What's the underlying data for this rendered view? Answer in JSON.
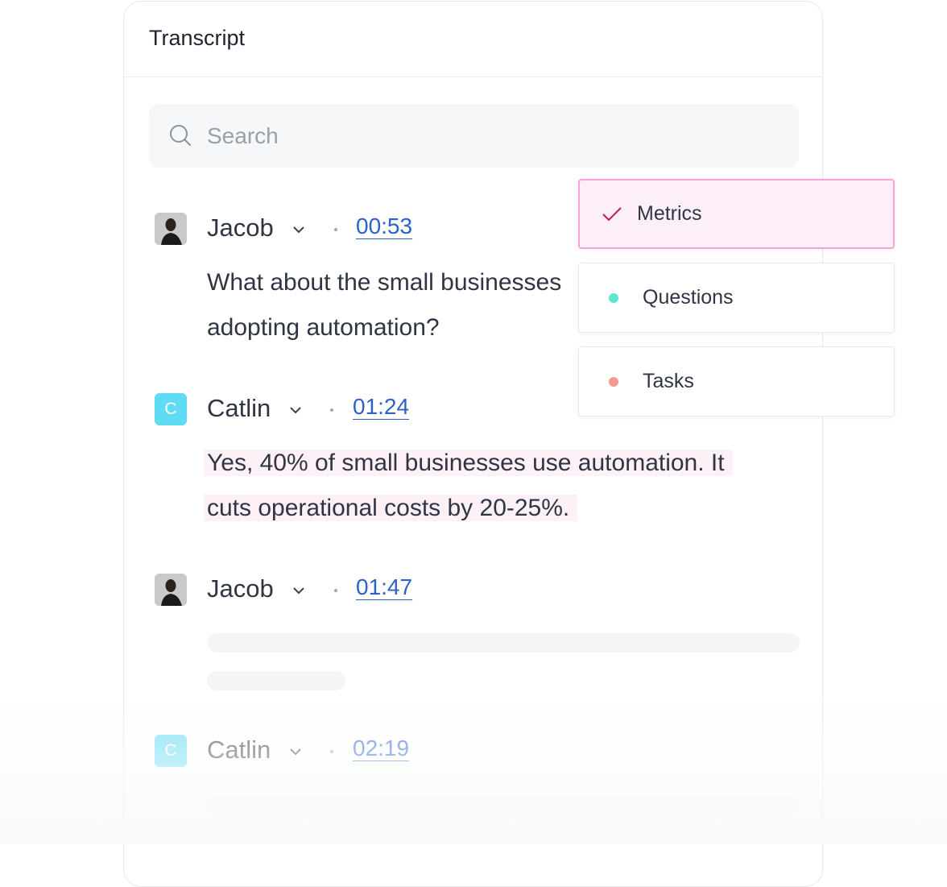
{
  "panel": {
    "title": "Transcript"
  },
  "search": {
    "placeholder": "Search",
    "icon": "search-icon"
  },
  "entries": [
    {
      "speaker": "Jacob",
      "avatar": "photo",
      "time": "00:53",
      "text_line1": "What about the small businesses",
      "text_line2": "adopting automation?"
    },
    {
      "speaker": "Catlin",
      "avatar_letter": "C",
      "time": "01:24",
      "text_line1": "Yes, 40% of small businesses use automation. It",
      "text_line2": "cuts operational costs by 20-25%.",
      "highlighted": true
    },
    {
      "speaker": "Jacob",
      "avatar": "photo",
      "time": "01:47",
      "loading": true
    },
    {
      "speaker": "Catlin",
      "avatar_letter": "C",
      "time": "02:19"
    }
  ],
  "tags": [
    {
      "label": "Metrics",
      "selected": true,
      "color": "#c2185b"
    },
    {
      "label": "Questions",
      "selected": false,
      "color": "#5ee6cf"
    },
    {
      "label": "Tasks",
      "selected": false,
      "color": "#f59a93"
    }
  ],
  "colors": {
    "link": "#2a62c9",
    "highlight": "#fdf0f7",
    "avatar_letter_bg": "#5fdcf3",
    "selected_tag_bg": "#fdeff8",
    "selected_tag_border": "#f6a2d8"
  }
}
